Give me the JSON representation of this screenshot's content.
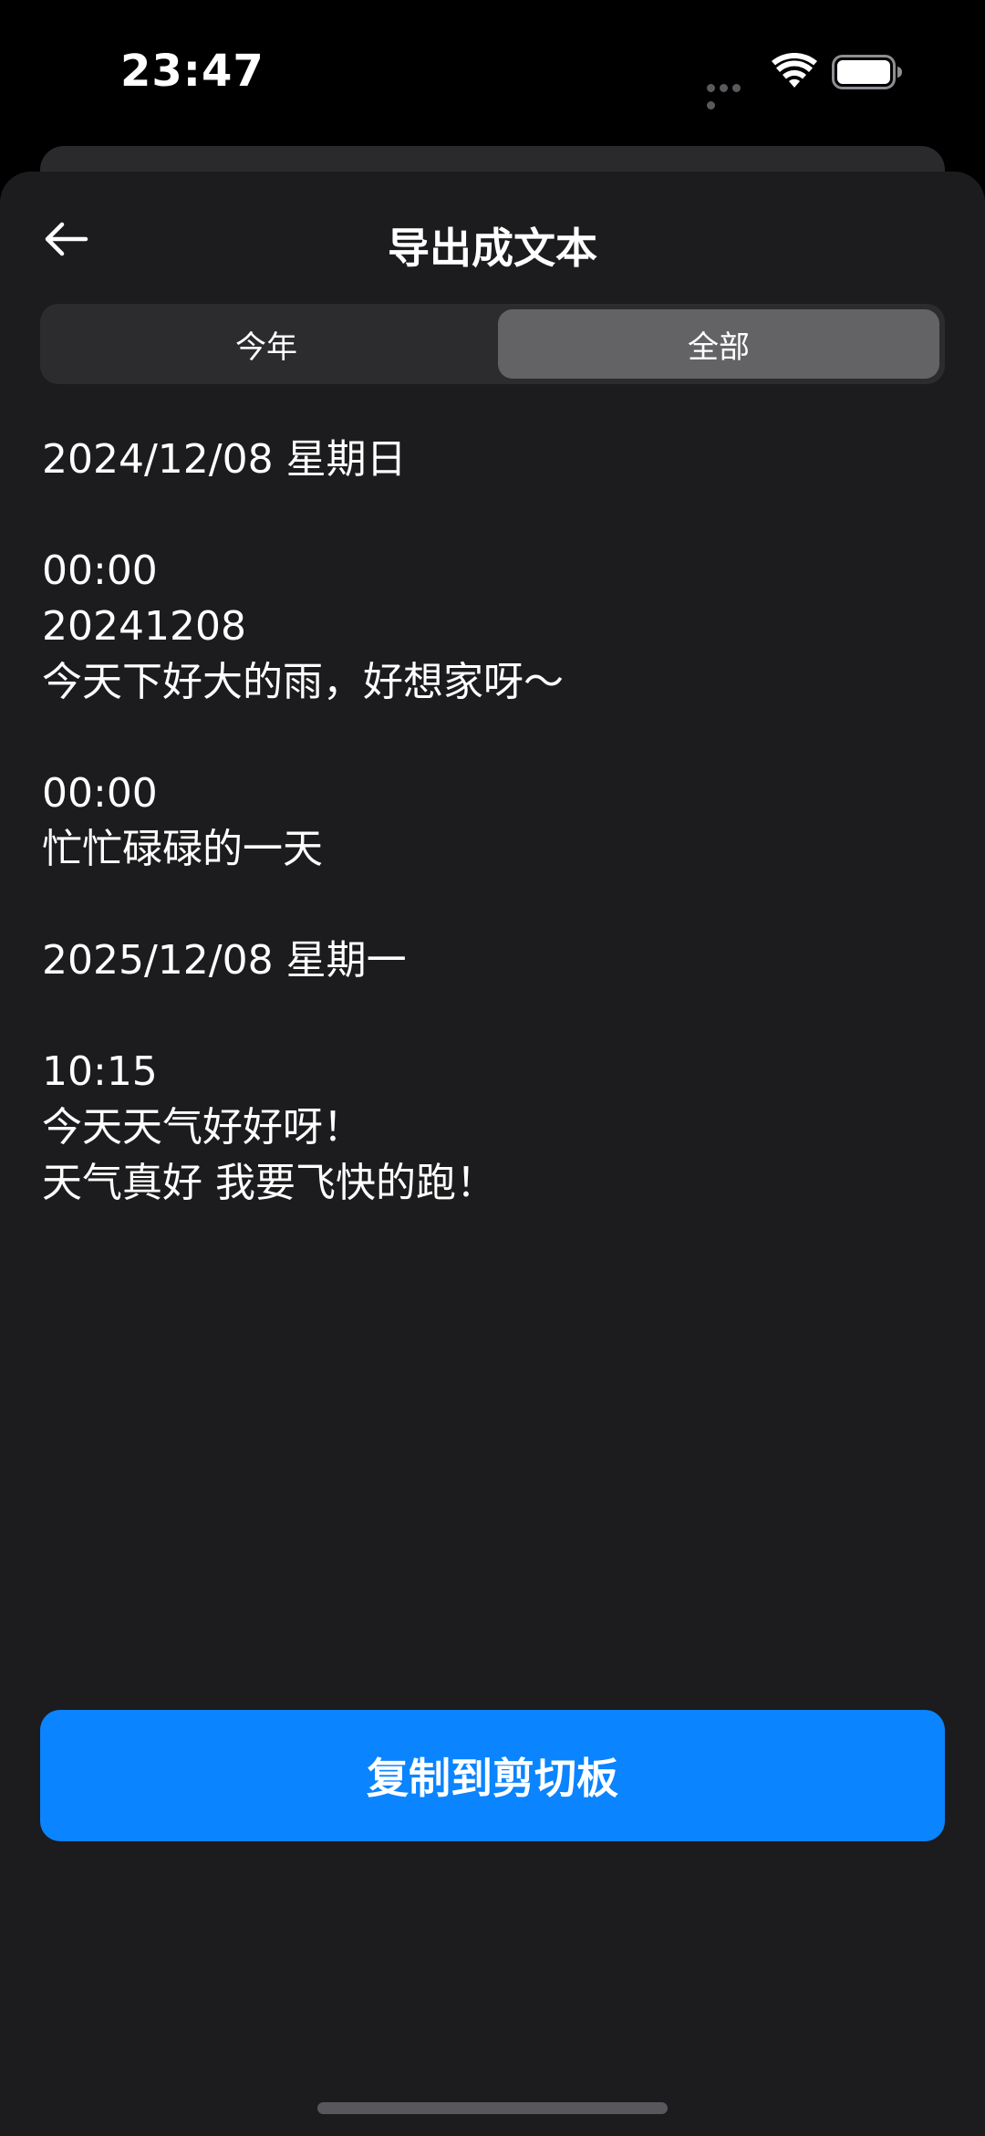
{
  "status_bar": {
    "time": "23:47"
  },
  "nav": {
    "title": "导出成文本"
  },
  "tabs": [
    {
      "label": "今年",
      "selected": false
    },
    {
      "label": "全部",
      "selected": true
    }
  ],
  "export_lines": [
    "2024/12/08 星期日",
    "",
    "00:00",
    "20241208",
    "今天下好大的雨，好想家呀～",
    "",
    "00:00",
    "忙忙碌碌的一天",
    "",
    "2025/12/08 星期一",
    "",
    "10:15",
    "今天天气好好呀！",
    "天气真好 我要飞快的跑！"
  ],
  "copy_button": {
    "label": "复制到剪切板"
  },
  "colors": {
    "background": "#000000",
    "sheet": "#1c1c1e",
    "segment_bg": "#2c2c2f",
    "segment_selected": "#636366",
    "accent": "#0a84ff"
  },
  "icons": {
    "back": "arrow-left-icon",
    "wifi": "wifi-icon",
    "battery": "battery-icon"
  }
}
